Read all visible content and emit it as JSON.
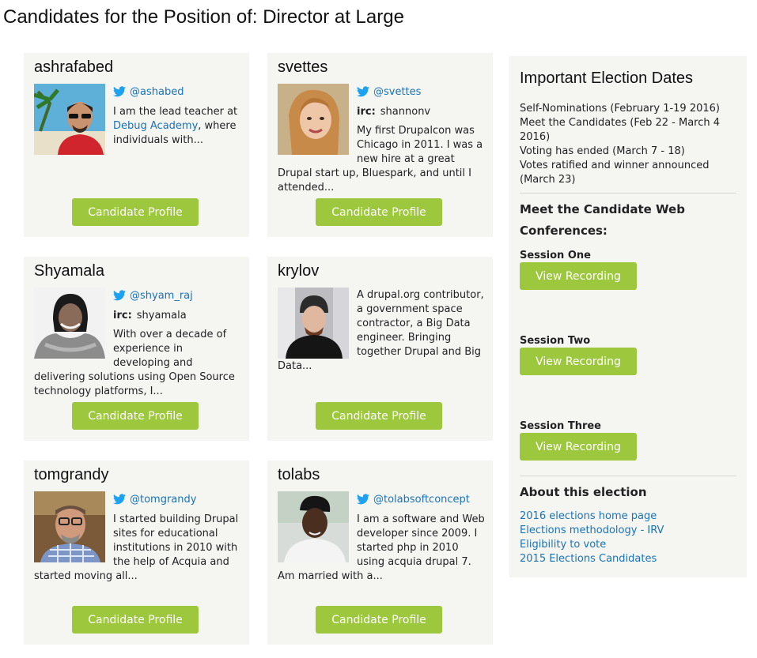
{
  "page": {
    "title": "Candidates for the Position of: Director at Large"
  },
  "colors": {
    "button_green": "#9dc83d",
    "link_blue": "#1a73b7",
    "card_bg": "#f5f5f2"
  },
  "candidates": [
    {
      "name": "ashrafabed",
      "twitter": "@ashabed",
      "irc": null,
      "bio_before_link": "I am the lead teacher at ",
      "bio_link": "Debug Academy",
      "bio_after_link": ", where individuals with...",
      "button": "Candidate Profile",
      "photo_icon": "candidate-photo"
    },
    {
      "name": "svettes",
      "twitter": "@svettes",
      "irc_label": "irc:",
      "irc": "shannonv",
      "bio": "My first Drupalcon was Chicago in 2011. I was a new hire at a great Drupal start up, Bluespark, and until I attended...",
      "button": "Candidate Profile",
      "photo_icon": "candidate-photo"
    },
    {
      "name": "Shyamala",
      "twitter": "@shyam_raj",
      "irc_label": "irc:",
      "irc": "shyamala",
      "bio": "With over a decade of experience in developing and delivering solutions using Open Source technology platforms, I...",
      "button": "Candidate Profile",
      "photo_icon": "candidate-photo"
    },
    {
      "name": "krylov",
      "twitter": null,
      "irc": null,
      "bio": "A drupal.org contributor, a government space contractor, a Big Data engineer. Bringing together Drupal and Big Data...",
      "button": "Candidate Profile",
      "photo_icon": "candidate-photo"
    },
    {
      "name": "tomgrandy",
      "twitter": "@tomgrandy",
      "irc": null,
      "bio": "I started building Drupal sites for educational institutions in 2010 with the help of Acquia and started moving all...",
      "button": "Candidate Profile",
      "photo_icon": "candidate-photo"
    },
    {
      "name": "tolabs",
      "twitter": "@tolabsoftconcept",
      "irc": null,
      "bio": "I am a software and Web developer since 2009. I started php in 2010 using acquia drupal 7. Am married with a...",
      "button": "Candidate Profile",
      "photo_icon": "candidate-photo"
    }
  ],
  "sidebar": {
    "title": "Important Election Dates",
    "dates": [
      "Self-Nominations (February 1-19 2016)",
      "Meet the Candidates (Feb 22 - March 4 2016)",
      "Voting has ended (March 7 - 18)",
      "Votes ratified and winner announced (March 23)"
    ],
    "conferences_heading": "Meet the Candidate Web Conferences:",
    "sessions": [
      {
        "label": "Session One",
        "button": "View Recording"
      },
      {
        "label": "Session Two",
        "button": "View Recording"
      },
      {
        "label": "Session Three",
        "button": "View Recording"
      }
    ],
    "about_heading": "About this election",
    "about_links": [
      "2016 elections home page",
      "Elections methodology - IRV",
      "Eligibility to vote",
      "2015 Elections Candidates"
    ]
  }
}
